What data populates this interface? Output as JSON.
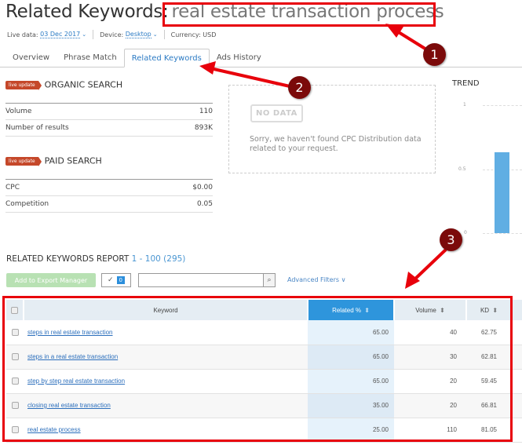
{
  "header": {
    "title_prefix": "Related Keywords:",
    "keyword": "real estate transaction process",
    "live_data_label": "Live data:",
    "live_data_value": "03 Dec 2017",
    "device_label": "Device:",
    "device_value": "Desktop",
    "currency": "Currency: USD"
  },
  "tabs": [
    {
      "label": "Overview",
      "active": false
    },
    {
      "label": "Phrase Match",
      "active": false
    },
    {
      "label": "Related Keywords",
      "active": true
    },
    {
      "label": "Ads History",
      "active": false
    }
  ],
  "organic": {
    "badge": "live update",
    "title": "ORGANIC SEARCH",
    "rows": [
      {
        "label": "Volume",
        "value": "110"
      },
      {
        "label": "Number of results",
        "value": "893K"
      }
    ]
  },
  "paid": {
    "badge": "live update",
    "title": "PAID SEARCH",
    "rows": [
      {
        "label": "CPC",
        "value": "$0.00"
      },
      {
        "label": "Competition",
        "value": "0.05"
      }
    ]
  },
  "cpc_distribution": {
    "no_data_label": "NO DATA",
    "message": "Sorry, we haven't found CPC Distribution data related to your request."
  },
  "trend": {
    "title": "TREND",
    "ticks": [
      "1",
      "0.5",
      "0"
    ],
    "ylim": [
      0,
      1
    ],
    "values": [
      0.63
    ]
  },
  "report": {
    "title": "RELATED KEYWORDS REPORT",
    "range": "1 - 100 (295)",
    "export_button": "Add to Export Manager",
    "selected_count": "0",
    "search_placeholder": "",
    "advanced_filters": "Advanced Filters",
    "columns": [
      "Keyword",
      "Related %",
      "Volume",
      "KD"
    ],
    "rows": [
      {
        "keyword": "steps in real estate transaction",
        "related": "65.00",
        "volume": "40",
        "kd": "62.75"
      },
      {
        "keyword": "steps in a real estate transaction",
        "related": "65.00",
        "volume": "30",
        "kd": "62.81"
      },
      {
        "keyword": "step by step real estate transaction",
        "related": "65.00",
        "volume": "20",
        "kd": "59.45"
      },
      {
        "keyword": "closing real estate transaction",
        "related": "35.00",
        "volume": "20",
        "kd": "66.81"
      },
      {
        "keyword": "real estate process",
        "related": "25.00",
        "volume": "110",
        "kd": "81.05"
      }
    ]
  },
  "annotations": [
    "1",
    "2",
    "3"
  ],
  "colors": {
    "accent": "#2c7bc4",
    "sorted_header": "#2e95dc",
    "badge": "#c5482a",
    "annotation": "#e8000b",
    "trend_bar": "#60aee3"
  }
}
